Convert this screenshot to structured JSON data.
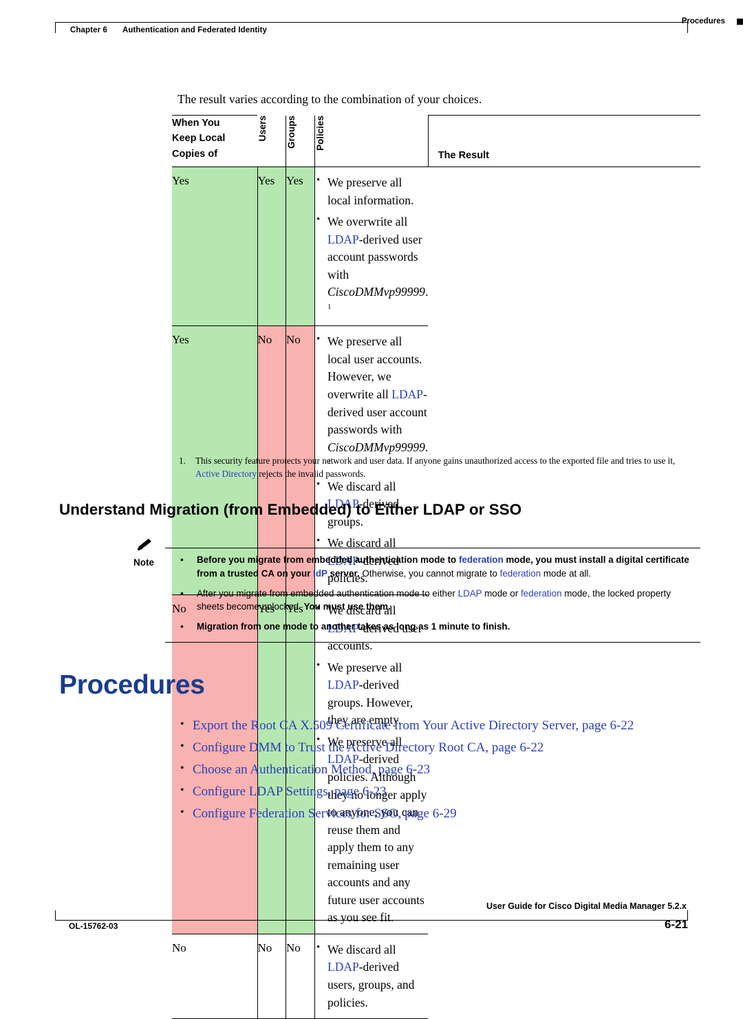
{
  "header": {
    "chapter_label": "Chapter 6",
    "chapter_title": "Authentication and Federated Identity",
    "right_label": "Procedures"
  },
  "intro": "The result varies according to the combination of your choices.",
  "table": {
    "when_heading_lines": [
      "When You",
      "Keep Local",
      "Copies of"
    ],
    "col_users": "Users",
    "col_groups": "Groups",
    "col_policies": "Policies",
    "result_heading": "The Result",
    "rows": [
      {
        "users": "Yes",
        "groups": "Yes",
        "policies": "Yes",
        "shade": "green",
        "bullets": [
          "We preserve all local information.",
          "We overwrite all LDAP-derived user account passwords with CiscoDMMvp99999. 1"
        ]
      },
      {
        "users": "Yes",
        "groups": "No",
        "policies": "No",
        "shade": "mixed",
        "bullets": [
          "We preserve all local user accounts. However, we overwrite all LDAP-derived user account passwords with CiscoDMMvp99999. 1",
          "We discard all LDAP-derived groups.",
          "We discard all LDAP-derived policies."
        ]
      },
      {
        "users": "No",
        "groups": "Yes",
        "policies": "Yes",
        "shade": "mixed2",
        "bullets": [
          "We discard all LDAP-derived user accounts.",
          "We preserve all LDAP-derived groups. However, they are empty.",
          "We preserve all LDAP-derived policies. Although they no longer apply to anyone, you can reuse them and apply them to any remaining user accounts and any future user accounts as you see fit."
        ]
      },
      {
        "users": "No",
        "groups": "No",
        "policies": "No",
        "shade": "none",
        "bullets": [
          "We discard all LDAP-derived users, groups, and policies."
        ]
      }
    ]
  },
  "footnote": {
    "number": "1.",
    "text_before": "This security feature protects your network and user data. If anyone gains unauthorized access to the exported file and tries to use it, ",
    "link": "Active Directory",
    "text_after": " rejects the invalid passwords."
  },
  "section_heading": "Understand Migration (from Embedded) to Either LDAP or SSO",
  "note": {
    "label": "Note",
    "bullets": [
      {
        "segments": [
          {
            "text": "Before you migrate from embedded authentication mode to ",
            "style": "bold"
          },
          {
            "text": "federation",
            "style": "bold-link"
          },
          {
            "text": " mode, you must install a digital certificate from a trusted CA on your ",
            "style": "bold"
          },
          {
            "text": "IdP",
            "style": "bold-link"
          },
          {
            "text": " server. Otherwise, you cannot migrate to ",
            "style": "normal"
          },
          {
            "text": "federation",
            "style": "link"
          },
          {
            "text": " mode at all.",
            "style": "normal"
          }
        ]
      },
      {
        "segments": [
          {
            "text": "After you migrate from embedded authentication mode to either ",
            "style": "normal"
          },
          {
            "text": "LDAP",
            "style": "link"
          },
          {
            "text": " mode or ",
            "style": "normal"
          },
          {
            "text": "federation",
            "style": "link"
          },
          {
            "text": " mode, the locked property sheets become unlocked. ",
            "style": "normal"
          },
          {
            "text": "You must use them.",
            "style": "bold"
          }
        ]
      },
      {
        "segments": [
          {
            "text": "Migration from one mode to another takes as long as 1 minute to finish.",
            "style": "bold"
          }
        ]
      }
    ]
  },
  "procedures": {
    "title": "Procedures",
    "links": [
      "Export the Root CA X.509 Certificate from Your Active Directory Server, page 6-22",
      "Configure DMM to Trust the Active Directory Root CA, page 6-22",
      "Choose an Authentication Method, page 6-23",
      "Configure LDAP Settings, page 6-23",
      "Configure Federation Services for SSO, page 6-29"
    ]
  },
  "footer": {
    "doc_id": "OL-15762-03",
    "guide": "User Guide for Cisco Digital Media Manager 5.2.x",
    "page": "6-21"
  },
  "colors": {
    "link": "#2b3fb5",
    "heading": "#1b3c8c",
    "green": "#b6e7b0",
    "pink": "#f8b2b0"
  }
}
